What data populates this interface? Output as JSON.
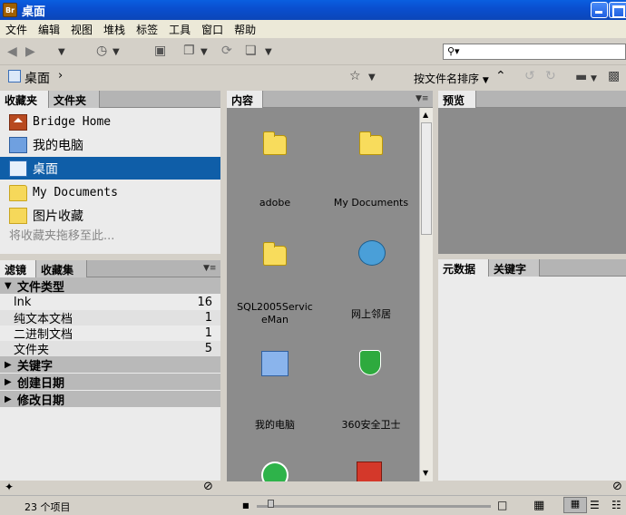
{
  "window": {
    "title": "桌面",
    "app_icon_text": "Br"
  },
  "menu": [
    "文件",
    "编辑",
    "视图",
    "堆栈",
    "标签",
    "工具",
    "窗口",
    "帮助"
  ],
  "toolbar": {
    "search_placeholder": "",
    "breadcrumb": "桌面",
    "sort_label": "按文件名排序"
  },
  "favorites": {
    "tabs": [
      "收藏夹",
      "文件夹"
    ],
    "items": [
      {
        "label": "Bridge Home",
        "icon": "bridge-home-icon",
        "selected": false
      },
      {
        "label": "我的电脑",
        "icon": "computer-icon",
        "selected": false
      },
      {
        "label": "桌面",
        "icon": "desktop-icon",
        "selected": true
      },
      {
        "label": "My Documents",
        "icon": "folder-icon",
        "selected": false
      },
      {
        "label": "图片收藏",
        "icon": "pictures-folder-icon",
        "selected": false
      }
    ],
    "drop_hint": "将收藏夹拖移至此..."
  },
  "filter": {
    "tabs": [
      "滤镜",
      "收藏集"
    ],
    "sections": [
      {
        "label": "文件类型",
        "expanded": true
      },
      {
        "label": "关键字",
        "expanded": false
      },
      {
        "label": "创建日期",
        "expanded": false
      },
      {
        "label": "修改日期",
        "expanded": false
      }
    ],
    "file_types": [
      {
        "name": "lnk",
        "count": "16"
      },
      {
        "name": "纯文本文档",
        "count": "1"
      },
      {
        "name": "二进制文档",
        "count": "1"
      },
      {
        "name": "文件夹",
        "count": "5"
      }
    ]
  },
  "content": {
    "tab": "内容",
    "items": [
      {
        "label": "adobe",
        "icon": "folder-icon"
      },
      {
        "label": "My Documents",
        "icon": "folder-icon"
      },
      {
        "label": "SQL2005ServiceMan",
        "icon": "folder-icon"
      },
      {
        "label": "网上邻居",
        "icon": "network-icon"
      },
      {
        "label": "我的电脑",
        "icon": "computer-icon"
      },
      {
        "label": "360安全卫士",
        "icon": "shield-icon"
      },
      {
        "label": "",
        "icon": "ie-icon"
      },
      {
        "label": "",
        "icon": "badge-app-icon"
      }
    ]
  },
  "preview": {
    "tab": "预览"
  },
  "metadata": {
    "tabs": [
      "元数据",
      "关键字"
    ]
  },
  "status": {
    "item_count": "23 个项目",
    "thumbnail_size_fraction": 0.06
  },
  "colors": {
    "selected": "#0f5ea8",
    "content_bg": "#8c8c8c",
    "panel_bg": "#ebebeb",
    "titlebar": "#0a4fd0"
  }
}
